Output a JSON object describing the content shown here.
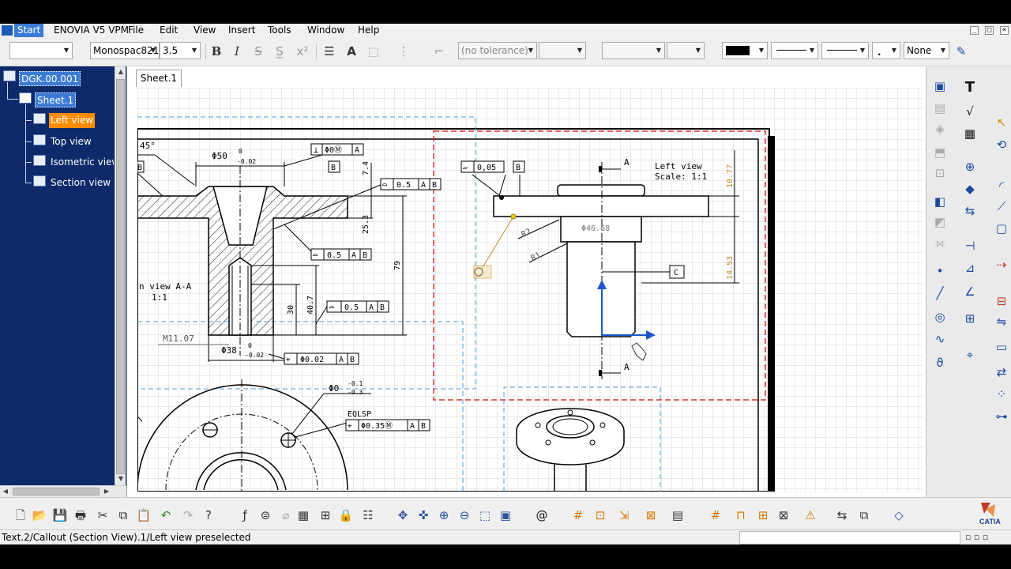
{
  "menu": {
    "items": [
      {
        "label": "Start"
      },
      {
        "label": "ENOVIA V5 VPM"
      },
      {
        "label": "File"
      },
      {
        "label": "Edit"
      },
      {
        "label": "View"
      },
      {
        "label": "Insert"
      },
      {
        "label": "Tools"
      },
      {
        "label": "Window"
      },
      {
        "label": "Help"
      }
    ],
    "window_buttons": [
      "_",
      "□",
      "✕"
    ]
  },
  "text_toolbar": {
    "style_value": "",
    "font_value": "Monospac821",
    "size_value": "3.5",
    "bold": "B",
    "italic": "I",
    "underline": "S",
    "tolerance_value": "(no tolerance)",
    "pattern_value": "None"
  },
  "tree": {
    "root": "DGK.00.001",
    "sheet": "Sheet.1",
    "views": [
      "Left view",
      "Top view",
      "Isometric view",
      "Section view A"
    ]
  },
  "sheet_tab": "Sheet.1",
  "drawing": {
    "section_view": {
      "chamfer": "45°",
      "dim_dia50": "Φ50",
      "dim_dia50_tol_upper": "0",
      "dim_dia50_tol_lower": "-0.02",
      "perp_frame": [
        "⊥",
        "Φ0Ⓜ",
        "A"
      ],
      "datum_b": "B",
      "dim_7_4": "7.4",
      "dim_25_3": "25.3",
      "dim_79": "79",
      "dim_30": "30",
      "dim_40_7": "40.7",
      "profile_frame_1": [
        "⌓",
        "0.5",
        "A",
        "B"
      ],
      "profile_frame_2": [
        "⌓",
        "0.5",
        "A",
        "B"
      ],
      "profile_frame_3": [
        "⌓",
        "0.5",
        "A",
        "B"
      ],
      "thread": "M11.07",
      "dim_dia38": "Φ38",
      "dim_dia38_tol_upper": "0",
      "dim_dia38_tol_lower": "-0.02",
      "position_frame": [
        "⌖",
        "Φ0.02",
        "A",
        "B"
      ],
      "view_name": "n view A-A",
      "view_scale": "1:1",
      "datum_left": "B"
    },
    "top_view": {
      "hole_dim": "Φ0",
      "hole_tol_upper": "-0.1",
      "hole_tol_lower": "-0.3",
      "eqlsp": "EQLSP",
      "position_frame": [
        "⌖",
        "Φ0.35Ⓜ",
        "A",
        "B"
      ]
    },
    "left_view": {
      "title": "Left view",
      "scale": "Scale:  1:1",
      "flatness_frame": [
        "▱",
        "0,05"
      ],
      "datum_b": "B",
      "section_mark_top": "A",
      "section_mark_bottom": "A",
      "dim_dia46": "Φ46.68",
      "radius_r2": "R2",
      "radius_r1": "R1",
      "dim_10_77": "10.77",
      "dim_14_53": "14.53",
      "datum_c": "C"
    }
  },
  "status": {
    "text": "Text.2/Callout (Section View).1/Left view preselected",
    "command_value": ""
  },
  "colors": {
    "tree_bg": "#0e2a6b",
    "highlight_orange": "#ff8c00",
    "selection_blue": "#3b7bd6",
    "view_frame_blue": "#4a9ad8",
    "active_view_red": "#e03030",
    "dimension_orange": "#c48a2c"
  }
}
